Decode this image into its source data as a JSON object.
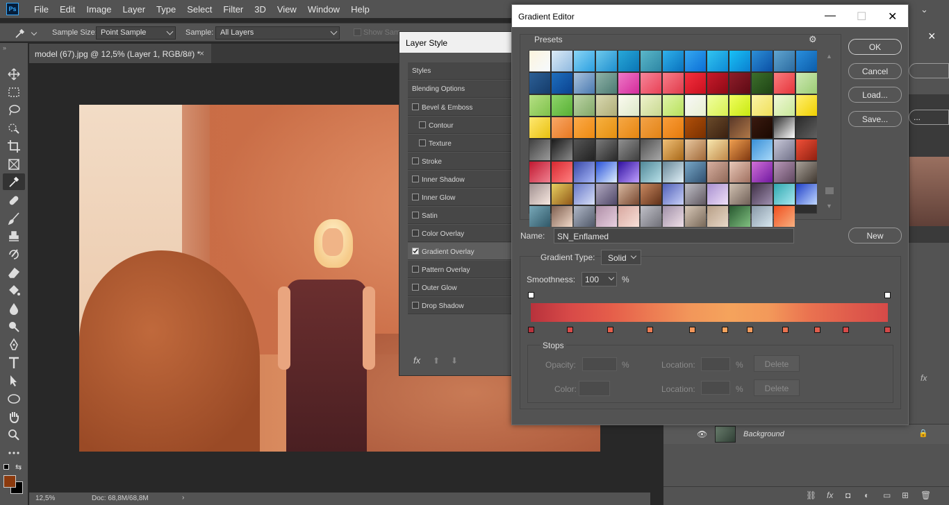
{
  "app": {
    "logo": "Ps"
  },
  "menu": [
    "File",
    "Edit",
    "Image",
    "Layer",
    "Type",
    "Select",
    "Filter",
    "3D",
    "View",
    "Window",
    "Help"
  ],
  "options": {
    "sample_size_label": "Sample Size:",
    "sample_size_value": "Point Sample",
    "sample_label": "Sample:",
    "sample_value": "All Layers",
    "show_sampling": "Show Sampling Ring"
  },
  "document": {
    "tab_title": "model (67).jpg @ 12,5% (Layer 1, RGB/8#) *",
    "close": "×",
    "zoom": "12,5%",
    "doc_size": "Doc: 68,8M/68,8M"
  },
  "colors": {
    "foreground": "#8b3a0e",
    "background": "#000000"
  },
  "layer_style": {
    "title": "Layer Style",
    "items": [
      {
        "label": "Styles",
        "checkbox": false,
        "checked": false,
        "indent": false
      },
      {
        "label": "Blending Options",
        "checkbox": false,
        "checked": false,
        "indent": false
      },
      {
        "label": "Bevel & Emboss",
        "checkbox": true,
        "checked": false,
        "indent": false
      },
      {
        "label": "Contour",
        "checkbox": true,
        "checked": false,
        "indent": true
      },
      {
        "label": "Texture",
        "checkbox": true,
        "checked": false,
        "indent": true
      },
      {
        "label": "Stroke",
        "checkbox": true,
        "checked": false,
        "indent": false
      },
      {
        "label": "Inner Shadow",
        "checkbox": true,
        "checked": false,
        "indent": false
      },
      {
        "label": "Inner Glow",
        "checkbox": true,
        "checked": false,
        "indent": false
      },
      {
        "label": "Satin",
        "checkbox": true,
        "checked": false,
        "indent": false
      },
      {
        "label": "Color Overlay",
        "checkbox": true,
        "checked": false,
        "indent": false
      },
      {
        "label": "Gradient Overlay",
        "checkbox": true,
        "checked": true,
        "indent": false
      },
      {
        "label": "Pattern Overlay",
        "checkbox": true,
        "checked": false,
        "indent": false
      },
      {
        "label": "Outer Glow",
        "checkbox": true,
        "checked": false,
        "indent": false
      },
      {
        "label": "Drop Shadow",
        "checkbox": true,
        "checked": false,
        "indent": false
      }
    ],
    "fx": "fx"
  },
  "gradient_editor": {
    "title": "Gradient Editor",
    "presets_label": "Presets",
    "buttons": {
      "ok": "OK",
      "cancel": "Cancel",
      "load": "Load...",
      "save": "Save...",
      "new": "New"
    },
    "name_label": "Name:",
    "name_value": "SN_Enflamed",
    "gradient_type_label": "Gradient Type:",
    "gradient_type_value": "Solid",
    "smoothness_label": "Smoothness:",
    "smoothness_value": "100",
    "percent": "%",
    "stops_label": "Stops",
    "opacity_label": "Opacity:",
    "color_label": "Color:",
    "location_label": "Location:",
    "delete_label": "Delete",
    "gradient_colors": [
      "#b8323c",
      "#d84a48",
      "#e55d4a",
      "#ec7a52",
      "#f2965a",
      "#f5a35c",
      "#f3995a",
      "#ea7350",
      "#e05d4c",
      "#d64a48"
    ],
    "stop_colors": [
      "#b8323c",
      "#d84a48",
      "#e55d4a",
      "#ec7a52",
      "#f2965a",
      "#f5a35c",
      "#f3995a",
      "#ea7350",
      "#e05d4c",
      "#d64a48",
      "#d24848"
    ],
    "presets": [
      [
        "#fdf4dc",
        "#f5faff"
      ],
      [
        "#dcebf6",
        "#8fb9e0"
      ],
      [
        "#8ad5f5",
        "#2b9fe0"
      ],
      [
        "#6ec9ec",
        "#1e8fcf"
      ],
      [
        "#28a8d8",
        "#0a75b5"
      ],
      [
        "#5bb7c9",
        "#2d86a4"
      ],
      [
        "#30b1ea",
        "#0871bd"
      ],
      [
        "#35a8f0",
        "#0b6ed6"
      ],
      [
        "#32c4f0",
        "#0c8ad6"
      ],
      [
        "#19c1f5",
        "#0a7fd0"
      ],
      [
        "#2d8fd6",
        "#0a4fa5"
      ],
      [
        "#60a5d0",
        "#2b6aa0"
      ],
      [
        "#2a8fdc",
        "#0b5caa"
      ],
      [
        "#2c5f95",
        "#153c6b"
      ],
      [
        "#1f6fbd",
        "#0a4290"
      ],
      [
        "#a9c3de",
        "#4a79b0"
      ],
      [
        "#8fb3a8",
        "#4c7a72"
      ],
      [
        "#ee79c7",
        "#d42b9b"
      ],
      [
        "#f6869a",
        "#e94155"
      ],
      [
        "#f77e8a",
        "#e03a4a"
      ],
      [
        "#f4303e",
        "#c9101f"
      ],
      [
        "#c71b2b",
        "#8e0915"
      ],
      [
        "#8e1e2a",
        "#5e0a14"
      ],
      [
        "#3c6e2c",
        "#1e4414"
      ],
      [
        "#f97c7e",
        "#e5343b"
      ],
      [
        "#cde8b4",
        "#9ccd74"
      ],
      [
        "#b5df84",
        "#7fc24b"
      ],
      [
        "#8ed46a",
        "#57b034"
      ],
      [
        "#bcd4a6",
        "#82a868"
      ],
      [
        "#d8d8b0",
        "#b0ae78"
      ],
      [
        "#fbfbf0",
        "#dde8c8"
      ],
      [
        "#eef3cc",
        "#c8d890"
      ],
      [
        "#dff5a8",
        "#b8e05c"
      ],
      [
        "#f8f8f8",
        "#e8f0d0"
      ],
      [
        "#f0ffa0",
        "#d8f050"
      ],
      [
        "#f0ff60",
        "#c8e810"
      ],
      [
        "#fbf4a6",
        "#f0df5a"
      ],
      [
        "#f0f8d8",
        "#c8e898"
      ],
      [
        "#fff070",
        "#f0d000"
      ],
      [
        "#ffe870",
        "#e8c010"
      ],
      [
        "#f8a868",
        "#e87820"
      ],
      [
        "#fbaa4a",
        "#ee8a10"
      ],
      [
        "#f7b040",
        "#e59010"
      ],
      [
        "#f6a845",
        "#e68510"
      ],
      [
        "#f3a348",
        "#e38315"
      ],
      [
        "#fa9d3a",
        "#e57a0b"
      ],
      [
        "#b0500a",
        "#7a3000"
      ],
      [
        "#6a4a2a",
        "#3a2010"
      ],
      [
        "#5a3828",
        "#b07848"
      ],
      [
        "#3a1a10",
        "#1a0800"
      ],
      [
        "#303030",
        "#ffffff"
      ],
      [
        "#2a2a2a",
        "#606060"
      ],
      [
        "#404040",
        "#9a9a9a"
      ],
      [
        "#1a1a1a",
        "#8a8a8a"
      ],
      [
        "#555",
        "#222"
      ],
      [
        "#7a7a7a",
        "#2a2a2a"
      ],
      [
        "#909090",
        "#404040"
      ],
      [
        "#505050",
        "#a8a8a8"
      ],
      [
        "#f0c078",
        "#a86818"
      ],
      [
        "#e8c8a0",
        "#a06838"
      ],
      [
        "#f8e8b0",
        "#c08848"
      ],
      [
        "#f0a050",
        "#803810"
      ],
      [
        "#3890d8",
        "#a8d8f8"
      ],
      [
        "#c8c8d8",
        "#707088"
      ],
      [
        "#f05038",
        "#902010"
      ],
      [
        "#c01830",
        "#f08090"
      ],
      [
        "#d82830",
        "#ff8080"
      ],
      [
        "#3848a8",
        "#a8b8f8"
      ],
      [
        "#2850d8",
        "#e0f0ff"
      ],
      [
        "#3010a0",
        "#c0a0ff"
      ],
      [
        "#508898",
        "#b8e0e8"
      ],
      [
        "#688898",
        "#e0f0f8"
      ],
      [
        "#78a8c8",
        "#305070"
      ],
      [
        "#d8b0a0",
        "#906858"
      ],
      [
        "#e8c8b8",
        "#a07060"
      ],
      [
        "#d070d8",
        "#7018a0"
      ],
      [
        "#b898b8",
        "#604860"
      ],
      [
        "#a8a098",
        "#403830"
      ],
      [
        "#a09090",
        "#f8e8e0"
      ],
      [
        "#e8d060",
        "#905818"
      ],
      [
        "#6878c8",
        "#d8e0f8"
      ],
      [
        "#b0a8c0",
        "#504868"
      ],
      [
        "#d8b8a0",
        "#784830"
      ],
      [
        "#c88860",
        "#603018"
      ],
      [
        "#5060b8",
        "#c8d0f8"
      ],
      [
        "#c0c0c8",
        "#605860"
      ],
      [
        "#a890d0",
        "#f0e0f8"
      ],
      [
        "#d0c0b0",
        "#706058"
      ],
      [
        "#403048",
        "#a090b0"
      ],
      [
        "#30a8b0",
        "#a8e8f0"
      ],
      [
        "#2040c8",
        "#c0d8ff"
      ],
      [
        "#78a8b8",
        "#305868"
      ],
      [
        "#806050",
        "#f0d8c8"
      ],
      [
        "#b0b8c8",
        "#505868"
      ],
      [
        "#b090a8",
        "#e8d0e0"
      ],
      [
        "#d8a8a0",
        "#f8e0d8"
      ],
      [
        "#c0c0c8",
        "#707078"
      ],
      [
        "#a090a8",
        "#f0e0e8"
      ],
      [
        "#d8c8b8",
        "#786858"
      ],
      [
        "#b8a088",
        "#e8d8c8"
      ],
      [
        "#285830",
        "#80c080"
      ],
      [
        "#8898a8",
        "#d8e8f0"
      ],
      [
        "#f05020",
        "#f8b080"
      ]
    ]
  },
  "layers": {
    "background_name": "Background",
    "fx_label": "fx"
  }
}
